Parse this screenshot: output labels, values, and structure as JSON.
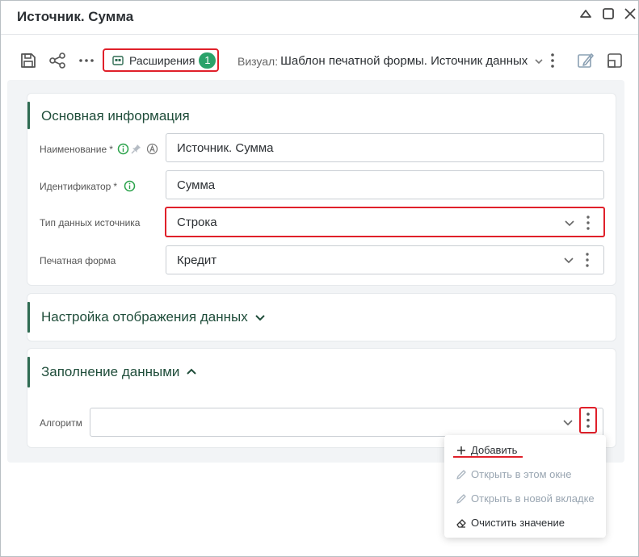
{
  "window": {
    "title": "Источник. Сумма"
  },
  "toolbar": {
    "extensions_label": "Расширения",
    "extensions_count": "1",
    "visual_label": "Визуал:",
    "visual_value": "Шаблон печатной формы. Источник данных"
  },
  "sections": {
    "main": {
      "title": "Основная информация",
      "fields": {
        "name": {
          "label": "Наименование",
          "required": "*",
          "value": "Источник. Сумма"
        },
        "id": {
          "label": "Идентификатор",
          "required": "*",
          "value": "Сумма"
        },
        "source_type": {
          "label": "Тип данных источника",
          "value": "Строка"
        },
        "print_form": {
          "label": "Печатная форма",
          "value": "Кредит"
        }
      }
    },
    "display": {
      "title": "Настройка отображения данных"
    },
    "filling": {
      "title": "Заполнение данными",
      "fields": {
        "algorithm": {
          "label": "Алгоритм",
          "value": ""
        }
      }
    }
  },
  "context_menu": {
    "items": [
      {
        "label": "Добавить",
        "icon": "plus-icon",
        "enabled": true
      },
      {
        "label": "Открыть в этом окне",
        "icon": "pencil-icon",
        "enabled": false
      },
      {
        "label": "Открыть в новой вкладке",
        "icon": "pencil-icon",
        "enabled": false
      },
      {
        "label": "Очистить значение",
        "icon": "eraser-icon",
        "enabled": true
      }
    ]
  },
  "colors": {
    "accent_green": "#2f6b52",
    "badge_green": "#2aa26a",
    "highlight_red": "#e0202a"
  }
}
